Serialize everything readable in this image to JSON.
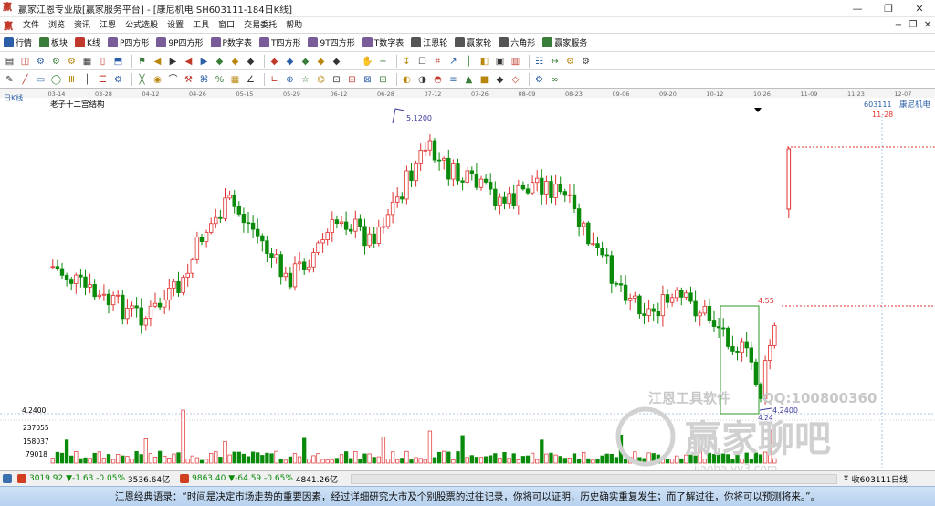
{
  "window": {
    "title": "赢家江恩专业版[赢家服务平台] - [康尼机电  SH603111-184日K线]",
    "buttons": [
      "—",
      "❐",
      "✕"
    ]
  },
  "menu": {
    "items": [
      "文件",
      "浏览",
      "资讯",
      "江恩",
      "公式选股",
      "设置",
      "工具",
      "窗口",
      "交易委托",
      "帮助"
    ],
    "mdi_buttons": [
      "−",
      "❐",
      "✕"
    ]
  },
  "toolbar1": {
    "items": [
      {
        "label": "行情",
        "icon": "grid-icon",
        "color": "#2b5ea7"
      },
      {
        "label": "板块",
        "icon": "blocks-icon",
        "color": "#3a7d3a"
      },
      {
        "label": "K线",
        "icon": "candles-icon",
        "color": "#c0392b"
      },
      {
        "label": "P四方形",
        "icon": "square-p-icon",
        "color": "#7a5c99"
      },
      {
        "label": "9P四方形",
        "icon": "square-9p-icon",
        "color": "#7a5c99"
      },
      {
        "label": "P数字表",
        "icon": "table-p-icon",
        "color": "#7a5c99"
      },
      {
        "label": "T四方形",
        "icon": "square-t-icon",
        "color": "#7a5c99"
      },
      {
        "label": "9T四方形",
        "icon": "square-9t-icon",
        "color": "#7a5c99"
      },
      {
        "label": "T数字表",
        "icon": "table-t-icon",
        "color": "#7a5c99"
      },
      {
        "label": "江恩轮",
        "icon": "wheel-icon",
        "color": "#555555"
      },
      {
        "label": "赢家轮",
        "icon": "wheel2-icon",
        "color": "#555555"
      },
      {
        "label": "六角形",
        "icon": "hexagon-icon",
        "color": "#555555"
      },
      {
        "label": "赢家服务",
        "icon": "dollar-icon",
        "color": "#3a7d3a"
      }
    ]
  },
  "chart_header": {
    "period_label": "日K线",
    "study_name": "老子十二宫结构",
    "code": "603111",
    "name": "康尼机电",
    "date": "11-28"
  },
  "chart_data": {
    "type": "candlestick",
    "x_ticks": [
      "03-14",
      "03-28",
      "04-12",
      "04-26",
      "05-15",
      "05-29",
      "06-12",
      "06-28",
      "07-12",
      "07-26",
      "08-09",
      "08-23",
      "09-06",
      "09-20",
      "10-12",
      "10-26",
      "11-09",
      "11-23",
      "12-07"
    ],
    "price_range": [
      4.24,
      5.12
    ],
    "annotations": {
      "high": "5.1200",
      "low": "4.2400",
      "low_short": "4.24",
      "last": "4.55",
      "min_axis": "4.2400"
    },
    "volume_ticks": [
      "237055",
      "158037",
      "79018"
    ],
    "colors": {
      "up": "#e03030",
      "down": "#0a8a0a",
      "box": "#2a9a2a",
      "ref": "#e03030",
      "grid": "#c8d8e8"
    }
  },
  "watermark": {
    "tools": "江恩工具软件",
    "qq": "QQ:100800360",
    "brand": "赢家聊吧",
    "site": "iiaoba.yv3.com"
  },
  "statusbar": {
    "sh": {
      "value": "3019.92",
      "change": "▼-1.63",
      "pct": "-0.05%",
      "amount": "3536.64亿"
    },
    "sz": {
      "value": "9863.40",
      "change": "▼-64.59",
      "pct": "-0.65%",
      "amount": "4841.26亿"
    },
    "right_text": "收603111日线"
  },
  "quote": "江恩经典语录：“时间是决定市场走势的重要因素，经过详细研究大市及个别股票的过往记录，你将可以证明，历史确实重复发生；而了解过往，你将可以预测将来。”。"
}
